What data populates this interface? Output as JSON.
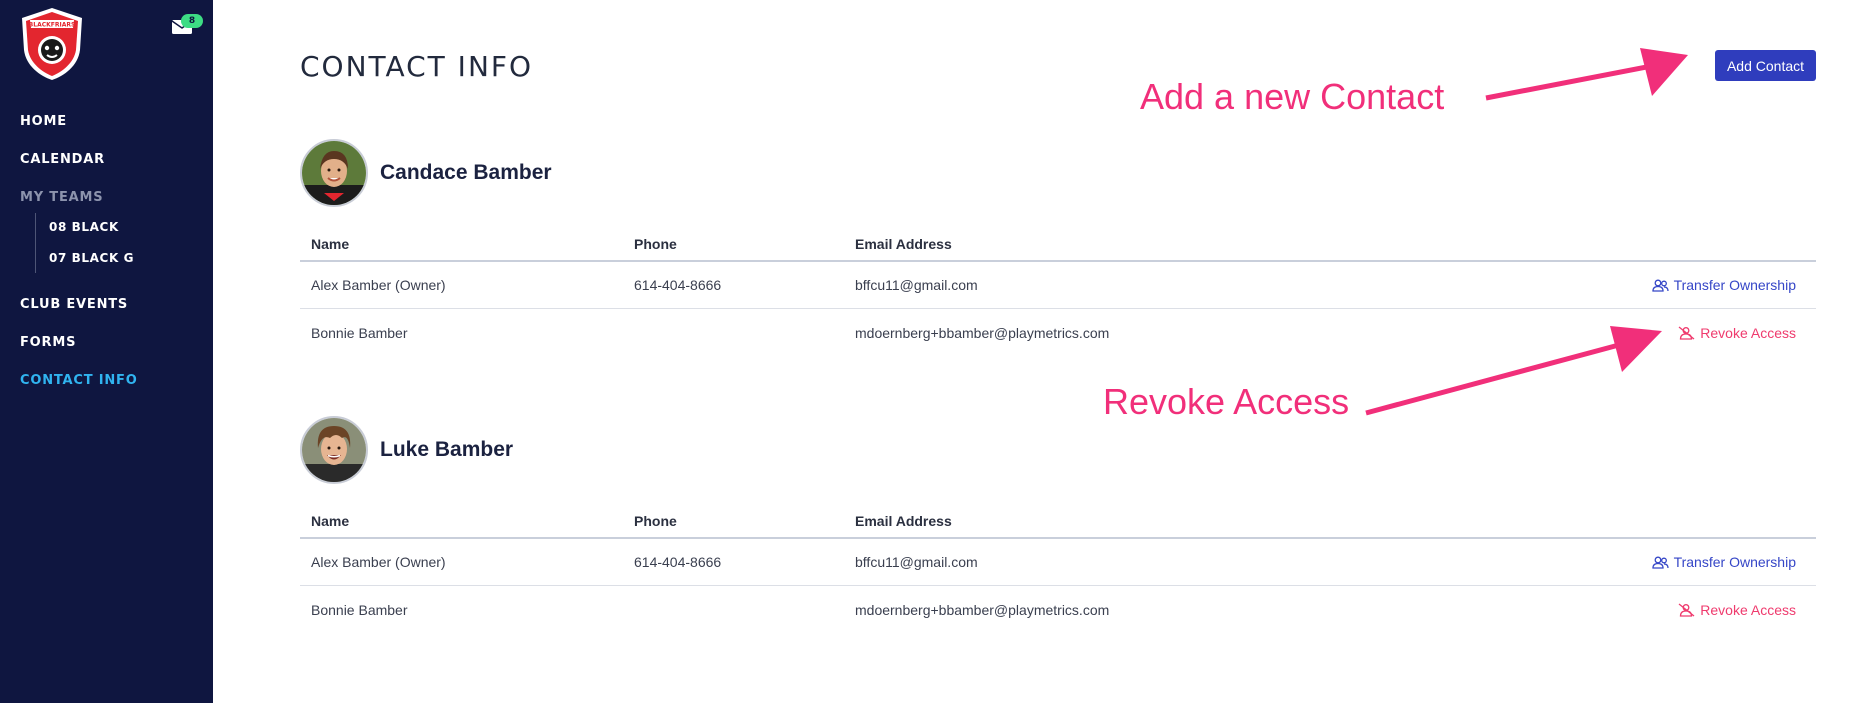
{
  "sidebar": {
    "logo_text": "BLACKFRIARS",
    "mail_count": "8",
    "nav": {
      "home": "HOME",
      "calendar": "CALENDAR",
      "my_teams": "MY TEAMS",
      "club_events": "CLUB EVENTS",
      "forms": "FORMS",
      "contact_info": "CONTACT INFO"
    },
    "teams": [
      "08 BLACK",
      "07 BLACK G"
    ]
  },
  "main": {
    "title": "CONTACT INFO",
    "add_contact_label": "Add Contact",
    "annotations": {
      "add": "Add a new Contact",
      "revoke": "Revoke Access"
    },
    "headers": {
      "name": "Name",
      "phone": "Phone",
      "email": "Email Address"
    },
    "players": [
      {
        "name": "Candace Bamber",
        "contacts": [
          {
            "name": "Alex Bamber (Owner)",
            "phone": "614-404-8666",
            "email": "bffcu11@gmail.com",
            "action": "Transfer Ownership"
          },
          {
            "name": "Bonnie Bamber",
            "phone": "",
            "email": "mdoernberg+bbamber@playmetrics.com",
            "action": "Revoke Access"
          }
        ]
      },
      {
        "name": "Luke Bamber",
        "contacts": [
          {
            "name": "Alex Bamber (Owner)",
            "phone": "614-404-8666",
            "email": "bffcu11@gmail.com",
            "action": "Transfer Ownership"
          },
          {
            "name": "Bonnie Bamber",
            "phone": "",
            "email": "mdoernberg+bbamber@playmetrics.com",
            "action": "Revoke Access"
          }
        ]
      }
    ]
  },
  "colors": {
    "sidebar_bg": "#0f1640",
    "active_nav": "#30b4f0",
    "primary_button": "#2f3dbd",
    "annotation": "#f12f7a",
    "revoke": "#ef3b6e",
    "transfer": "#3546c7"
  }
}
